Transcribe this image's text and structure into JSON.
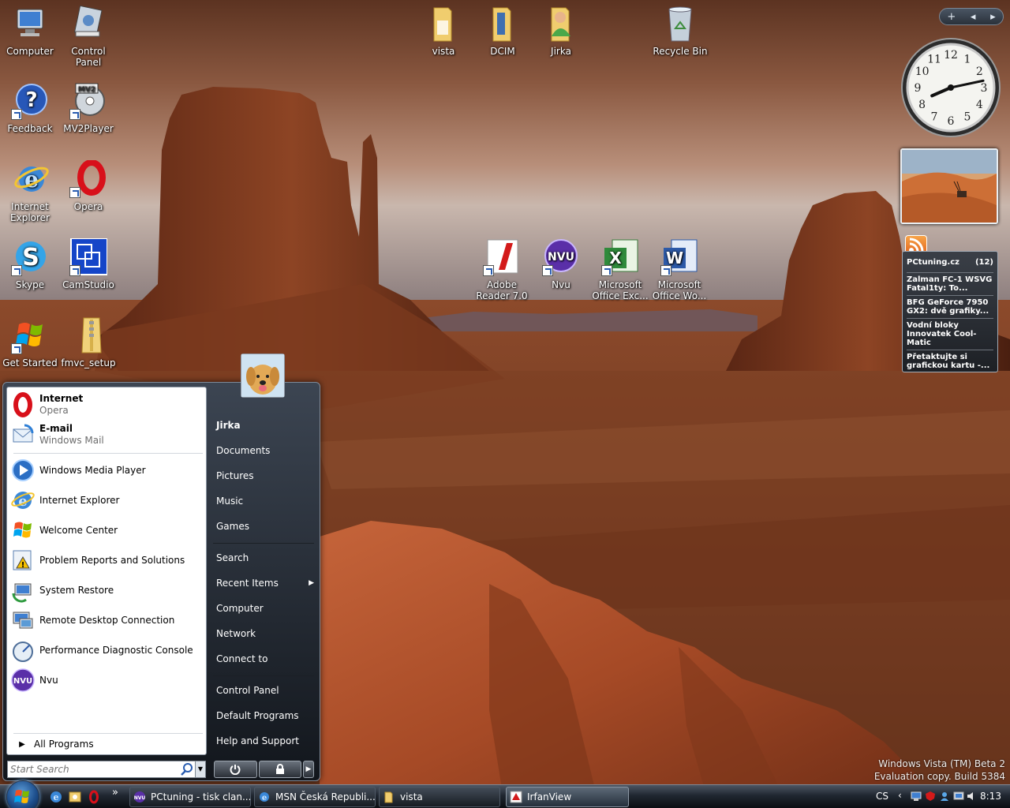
{
  "desktop": {
    "icons_left": [
      {
        "label": "Computer",
        "icon": "computer-icon"
      },
      {
        "label": "Control Panel",
        "icon": "control-panel-icon"
      },
      {
        "label": "Feedback",
        "icon": "feedback-icon"
      },
      {
        "label": "MV2Player",
        "icon": "mv2player-icon"
      },
      {
        "label": "Internet Explorer",
        "icon": "internet-explorer-icon"
      },
      {
        "label": "Opera",
        "icon": "opera-icon"
      },
      {
        "label": "Skype",
        "icon": "skype-icon"
      },
      {
        "label": "CamStudio",
        "icon": "camstudio-icon"
      },
      {
        "label": "Get Started",
        "icon": "windows-flag-icon"
      },
      {
        "label": "fmvc_setup",
        "icon": "zip-folder-icon"
      }
    ],
    "icons_top": [
      {
        "label": "vista",
        "icon": "folder-icon"
      },
      {
        "label": "DCIM",
        "icon": "folder-icon"
      },
      {
        "label": "Jirka",
        "icon": "user-folder-icon"
      },
      {
        "label": "Recycle Bin",
        "icon": "recycle-bin-icon"
      }
    ],
    "icons_middle": [
      {
        "label": "Adobe Reader 7.0",
        "icon": "adobe-reader-icon"
      },
      {
        "label": "Nvu",
        "icon": "nvu-icon"
      },
      {
        "label": "Microsoft Office Exc...",
        "icon": "excel-icon"
      },
      {
        "label": "Microsoft Office Wo...",
        "icon": "word-icon"
      }
    ]
  },
  "sidebar": {
    "controls": {
      "add": "+",
      "prev": "◂",
      "next": "▸"
    },
    "clock": {
      "hour": 8,
      "minute": 13,
      "numbers": [
        "12",
        "1",
        "2",
        "3",
        "4",
        "5",
        "6",
        "7",
        "8",
        "9",
        "10",
        "11"
      ]
    },
    "feed": {
      "title": "PCtuning.cz",
      "count": "(12)",
      "items": [
        "Zalman FC-1 WSVG Fatal1ty: To...",
        "BFG GeForce 7950 GX2: dvě grafiky...",
        "Vodní bloky Innovatek Cool-Matic",
        "Přetaktujte si grafickou kartu -..."
      ]
    }
  },
  "watermark": {
    "line1": "Windows Vista (TM) Beta 2",
    "line2": "Evaluation copy. Build 5384"
  },
  "start_menu": {
    "pinned": [
      {
        "title": "Internet",
        "subtitle": "Opera",
        "icon": "opera-icon"
      },
      {
        "title": "E-mail",
        "subtitle": "Windows Mail",
        "icon": "windows-mail-icon"
      }
    ],
    "recent": [
      {
        "label": "Windows Media Player",
        "icon": "media-player-icon"
      },
      {
        "label": "Internet Explorer",
        "icon": "internet-explorer-icon"
      },
      {
        "label": "Welcome Center",
        "icon": "windows-flag-icon"
      },
      {
        "label": "Problem Reports and Solutions",
        "icon": "problem-reports-icon"
      },
      {
        "label": "System Restore",
        "icon": "system-restore-icon"
      },
      {
        "label": "Remote Desktop Connection",
        "icon": "remote-desktop-icon"
      },
      {
        "label": "Performance Diagnostic Console",
        "icon": "performance-icon"
      },
      {
        "label": "Nvu",
        "icon": "nvu-icon"
      }
    ],
    "all_programs": "All Programs",
    "search_placeholder": "Start Search",
    "right": {
      "user": "Jirka",
      "group1": [
        "Documents",
        "Pictures",
        "Music",
        "Games"
      ],
      "group2": [
        "Search",
        "Recent Items",
        "Computer",
        "Network",
        "Connect to"
      ],
      "group3": [
        "Control Panel",
        "Default Programs",
        "Help and Support"
      ]
    }
  },
  "taskbar": {
    "quick_launch": [
      "ie-icon",
      "desktop-icon",
      "opera-icon"
    ],
    "overflow": "»",
    "tasks": [
      {
        "label": "PCtuning - tisk clan...",
        "icon": "nvu-icon"
      },
      {
        "label": "MSN Česká Republi...",
        "icon": "internet-explorer-icon"
      },
      {
        "label": "vista",
        "icon": "folder-icon"
      },
      {
        "label": "IrfanView",
        "icon": "irfanview-icon"
      }
    ],
    "tray": {
      "language": "CS",
      "time": "8:13"
    }
  },
  "colors": {
    "accent": "#2a5db0",
    "taskbar_dark": "#0b0e12",
    "start_menu_dark": "#12161c",
    "opera_red": "#d8101a"
  }
}
